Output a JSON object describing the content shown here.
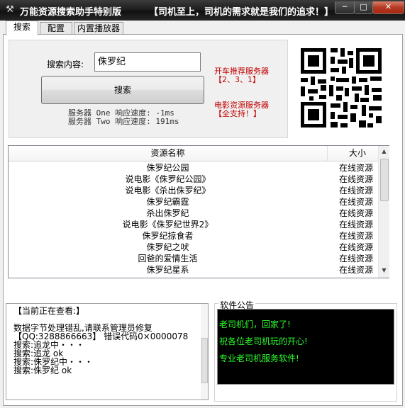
{
  "window": {
    "title": "万能资源搜索助手特别版",
    "slogan": "【司机至上，司机的需求就是我们的追求！】",
    "min_label": "─",
    "max_label": "□",
    "close_label": "✕"
  },
  "tabs": [
    {
      "label": "搜索"
    },
    {
      "label": "配置"
    },
    {
      "label": "内置播放器"
    }
  ],
  "search": {
    "label": "搜索内容:",
    "value": "侏罗纪",
    "button_label": "搜索",
    "speed_one": "服务器 One 响应速度: -1ms",
    "speed_two": "服务器 Two 响应速度: 191ms"
  },
  "promo": {
    "line1": "开车推荐服务器",
    "line2": "【2、3、1】",
    "line3": "电影资源服务器",
    "line4": "【全支持！】"
  },
  "results": {
    "col_name": "资源名称",
    "col_size": "大小",
    "rows": [
      {
        "name": "侏罗纪公园",
        "size": "在线资源"
      },
      {
        "name": "说电影《侏罗纪公园》",
        "size": "在线资源"
      },
      {
        "name": "说电影《杀出侏罗纪》",
        "size": "在线资源"
      },
      {
        "name": "侏罗纪霸霆",
        "size": "在线资源"
      },
      {
        "name": "杀出侏罗纪",
        "size": "在线资源"
      },
      {
        "name": "说电影《侏罗纪世界2》",
        "size": "在线资源"
      },
      {
        "name": "侏罗纪掠食者",
        "size": "在线资源"
      },
      {
        "name": "侏罗纪之吠",
        "size": "在线资源"
      },
      {
        "name": "回爸的爱情生活",
        "size": "在线资源"
      },
      {
        "name": "侏罗纪星系",
        "size": "在线资源"
      }
    ]
  },
  "log": {
    "lines": [
      "【当前正在查看:】",
      "数据字节处理错乱,请联系管理员修复",
      "【QQ:3288866663】  错误代码0×0000078",
      "搜索:追龙中・・・",
      "搜索:追龙  ok",
      "搜索:侏罗纪中・・・",
      "搜索:侏罗纪  ok"
    ]
  },
  "notice": {
    "title": "软件公告",
    "lines": [
      "老司机们，回家了!",
      "祝各位老司机玩的开心!",
      "专业老司机服务软件!"
    ]
  }
}
